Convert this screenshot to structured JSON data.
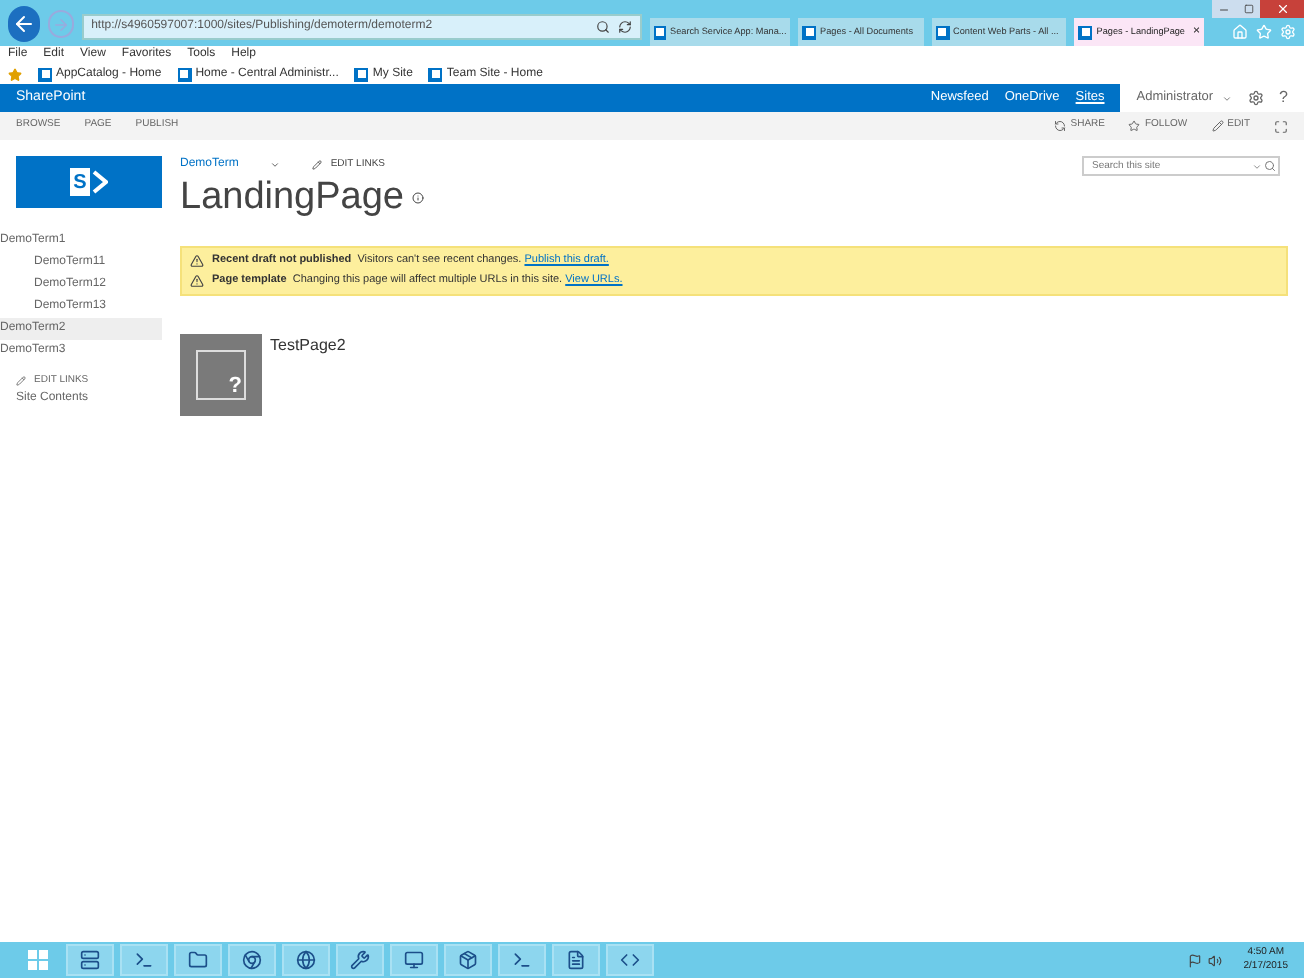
{
  "browser": {
    "address": "http://s4960597007:1000/sites/Publishing/demoterm/demoterm2",
    "tabs": [
      {
        "label": "Search Service App: Mana...",
        "selected": false
      },
      {
        "label": "Pages - All Documents",
        "selected": false
      },
      {
        "label": "Content Web Parts - All ...",
        "selected": false
      },
      {
        "label": "Pages - LandingPage",
        "selected": true
      }
    ],
    "tab_close": "×",
    "menu": [
      "File",
      "Edit",
      "View",
      "Favorites",
      "Tools",
      "Help"
    ],
    "favorites": [
      "AppCatalog - Home",
      "Home - Central Administr...",
      "My Site",
      "Team Site - Home"
    ]
  },
  "suite_bar": {
    "brand": "SharePoint",
    "links": [
      {
        "label": "Newsfeed",
        "selected": false
      },
      {
        "label": "OneDrive",
        "selected": false
      },
      {
        "label": "Sites",
        "selected": true
      }
    ],
    "user": "Administrator",
    "help": "?"
  },
  "ribbon": {
    "tabs": [
      "BROWSE",
      "PAGE",
      "PUBLISH"
    ],
    "actions": [
      "SHARE",
      "FOLLOW",
      "EDIT"
    ]
  },
  "logo_letter": "S",
  "breadcrumb": "DemoTerm",
  "edit_links": "EDIT LINKS",
  "title": "LandingPage",
  "search": {
    "placeholder": "Search this site"
  },
  "nav": [
    {
      "label": "DemoTerm1",
      "selected": false,
      "children": [
        {
          "label": "DemoTerm11",
          "selected": false
        },
        {
          "label": "DemoTerm12",
          "selected": false
        },
        {
          "label": "DemoTerm13",
          "selected": false
        }
      ]
    },
    {
      "label": "DemoTerm2",
      "selected": true
    },
    {
      "label": "DemoTerm3",
      "selected": false
    }
  ],
  "nav_edit_links": "EDIT LINKS",
  "site_contents": "Site Contents",
  "notifications": [
    {
      "title": "Recent draft not published",
      "text": "Visitors can't see recent changes.",
      "link": "Publish this draft."
    },
    {
      "title": "Page template",
      "text": "Changing this page will affect multiple URLs in this site.",
      "link": "View URLs."
    }
  ],
  "tiles": [
    {
      "title": "TestPage2",
      "placeholder_mark": "?"
    }
  ],
  "taskbar": {
    "time": "4:50 AM",
    "date": "2/17/2015"
  }
}
